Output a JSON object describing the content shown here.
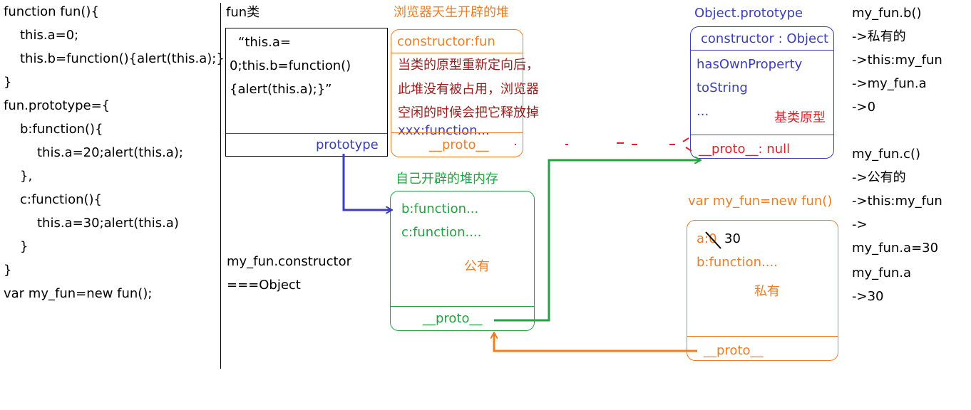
{
  "code": {
    "lines": [
      "function fun(){",
      "this.a=0;",
      "this.b=function(){alert(this.a);}",
      "}",
      "fun.prototype={",
      "b:function(){",
      "this.a=20;alert(this.a);",
      "},",
      "c:function(){",
      "this.a=30;alert(this.a)",
      "}",
      "}",
      "var my_fun=new fun();"
    ]
  },
  "fun_class": {
    "title": "fun类",
    "body_lines": [
      "“this.a=",
      "0;this.b=function()",
      "{alert(this.a);}”"
    ],
    "prototype_label": "prototype"
  },
  "browser_heap": {
    "title": "浏览器天生开辟的堆",
    "constructor": "constructor:fun",
    "note_lines": [
      "当类的原型重新定向后，",
      "此堆没有被占用，浏览器",
      "空闲的时候会把它释放掉"
    ],
    "method": "xxx:function...",
    "proto": "__proto__"
  },
  "own_heap": {
    "title": "自己开辟的堆内存",
    "items": [
      "b:function...",
      "c:function...."
    ],
    "tag": "公有",
    "proto": "__proto__"
  },
  "object_prototype": {
    "title": "Object.prototype",
    "constructor": "constructor : Object",
    "items": [
      "hasOwnProperty",
      "toString",
      "..."
    ],
    "tag": "基类原型",
    "proto": "__proto__: null"
  },
  "instance": {
    "title": "var my_fun=new fun()",
    "a_label": "a:0",
    "a_value": "30",
    "b_label": "b:function....",
    "tag": "私有",
    "proto": "__proto__"
  },
  "constructor_note": {
    "lines": [
      "my_fun.constructor",
      "===Object"
    ]
  },
  "right_notes": {
    "lines": [
      "my_fun.b()",
      "->私有的",
      "->this:my_fun",
      "->my_fun.a",
      "->0",
      "my_fun.c()",
      "->公有的",
      "->this:my_fun",
      "->",
      "my_fun.a=30",
      "my_fun.a",
      "->30"
    ]
  },
  "colors": {
    "orange": "#f07d22",
    "green": "#25a243",
    "blue": "#3b3fb8",
    "red": "#e0202a",
    "dark_red": "#9b1b1b"
  }
}
